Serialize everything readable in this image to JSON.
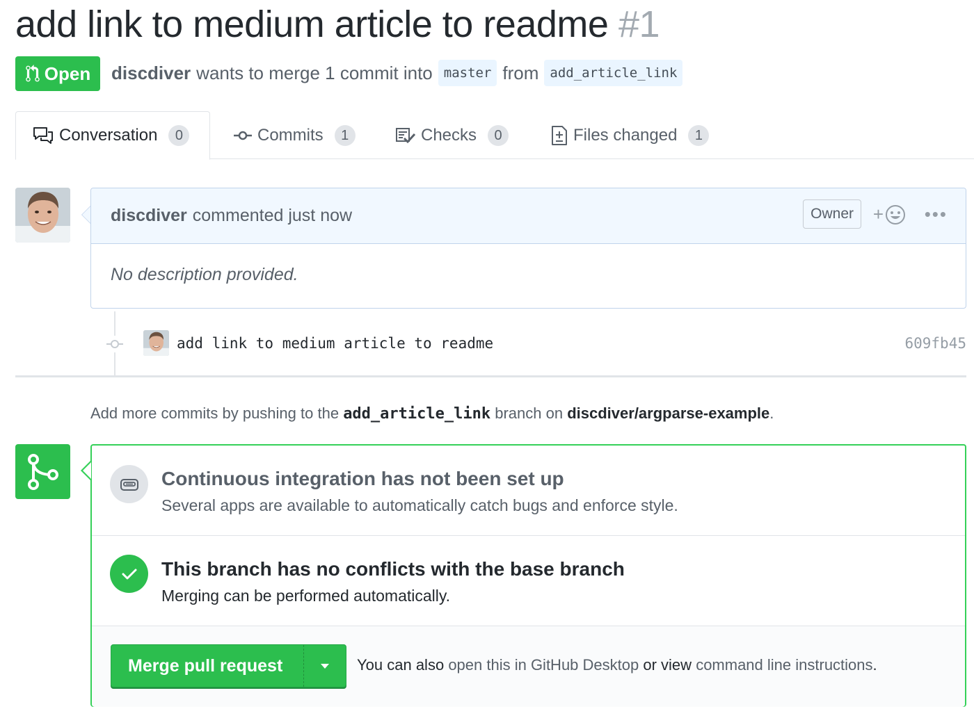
{
  "pr": {
    "title": "add link to medium article to readme",
    "number": "#1",
    "state": "Open",
    "author": "discdiver",
    "merge_text": "wants to merge 1 commit into",
    "base_branch": "master",
    "from_word": "from",
    "head_branch": "add_article_link"
  },
  "tabs": [
    {
      "label": "Conversation",
      "count": "0",
      "icon": "comment-discussion-icon"
    },
    {
      "label": "Commits",
      "count": "1",
      "icon": "git-commit-icon"
    },
    {
      "label": "Checks",
      "count": "0",
      "icon": "checklist-icon"
    },
    {
      "label": "Files changed",
      "count": "1",
      "icon": "diff-icon"
    }
  ],
  "comment": {
    "author": "discdiver",
    "meta": "commented just now",
    "role": "Owner",
    "react_label": "+",
    "more_label": "•••",
    "body": "No description provided."
  },
  "commit": {
    "message": "add link to medium article to readme",
    "sha": "609fb45"
  },
  "push_hint": {
    "prefix": "Add more commits by pushing to the",
    "branch": "add_article_link",
    "middle": "branch on",
    "repo": "discdiver/argparse-example",
    "suffix": "."
  },
  "merge": {
    "ci_title": "Continuous integration has not been set up",
    "ci_sub": "Several apps are available to automatically catch bugs and enforce style.",
    "conflict_title": "This branch has no conflicts with the base branch",
    "conflict_sub": "Merging can be performed automatically.",
    "button_label": "Merge pull request",
    "alt_prefix": "You can also",
    "alt_link1": "open this in GitHub Desktop",
    "alt_middle": "or view",
    "alt_link2": "command line instructions",
    "alt_suffix": "."
  },
  "colors": {
    "green": "#2cbe4e",
    "link": "#586069",
    "comment_header_bg": "#f1f8ff"
  }
}
